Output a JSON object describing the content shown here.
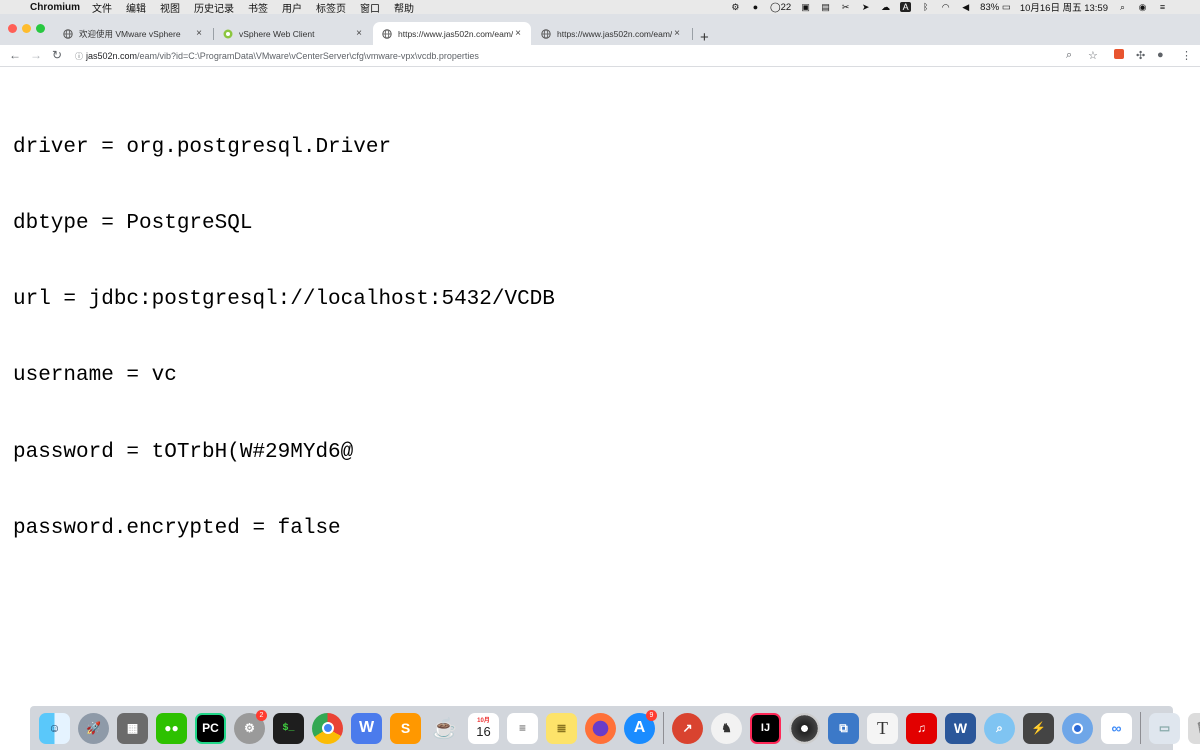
{
  "menubar": {
    "app_name": "Chromium",
    "items": [
      "文件",
      "编辑",
      "视图",
      "历史记录",
      "书签",
      "用户",
      "标签页",
      "窗口",
      "帮助"
    ],
    "status": {
      "notification_count": "22",
      "battery": "83%",
      "datetime": "10月16日 周五  13:59"
    }
  },
  "tabs": [
    {
      "title": "欢迎使用 VMware vSphere",
      "icon": "globe-icon",
      "active": false
    },
    {
      "title": "vSphere Web Client",
      "icon": "vsphere-icon",
      "active": false
    },
    {
      "title": "https://www.jas502n.com/eam/",
      "icon": "globe-icon",
      "active": true
    },
    {
      "title": "https://www.jas502n.com/eam/",
      "icon": "globe-icon",
      "active": false
    }
  ],
  "address": {
    "host": "jas502n.com",
    "path": "/eam/vib?id=C:\\ProgramData\\VMware\\vCenterServer\\cfg\\vmware-vpx\\vcdb.properties"
  },
  "page": {
    "lines": [
      "driver = org.postgresql.Driver",
      "dbtype = PostgreSQL",
      "url = jdbc:postgresql://localhost:5432/VCDB",
      "username = vc",
      "password = tOTrbH(W#29MYd6@",
      "password.encrypted = false"
    ]
  },
  "dock": {
    "calendar_month": "10月",
    "calendar_day": "16",
    "system_prefs_badge": "2",
    "appstore_badge": "9",
    "terminal_text": "$_",
    "pycharm_text": "PC",
    "intellij_text": "IJ",
    "word_text": "W",
    "wps_text": "W",
    "typora_text": "T"
  },
  "colors": {
    "menubar_bg": "#e9e9e9",
    "tabstrip_bg": "#dee1e6",
    "traffic_red": "#ff5f57",
    "traffic_yellow": "#febc2e",
    "traffic_green": "#28c840",
    "text": "#000000"
  }
}
